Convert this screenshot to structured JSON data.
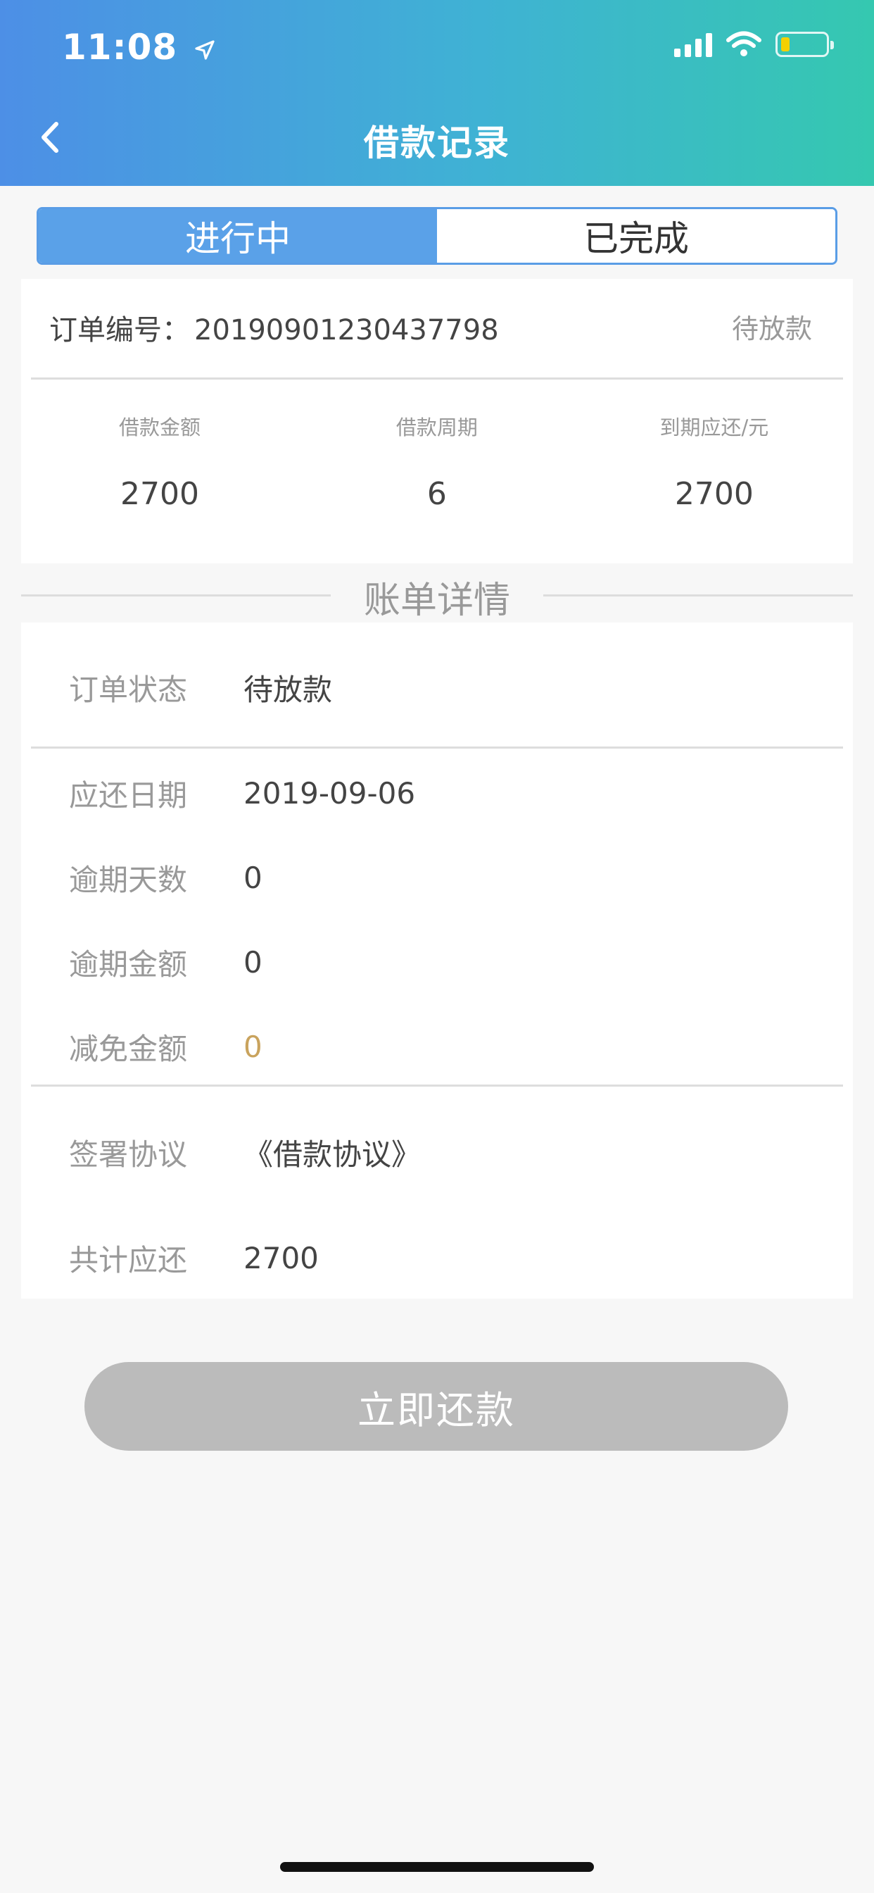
{
  "status_bar": {
    "time": "11:08"
  },
  "header": {
    "title": "借款记录"
  },
  "tabs": [
    {
      "label": "进行中",
      "active": true
    },
    {
      "label": "已完成",
      "active": false
    }
  ],
  "order": {
    "number_label": "订单编号：",
    "number": "20190901230437798",
    "status": "待放款",
    "stats": [
      {
        "label": "借款金额",
        "value": "2700"
      },
      {
        "label": "借款周期",
        "value": "6"
      },
      {
        "label": "到期应还/元",
        "value": "2700"
      }
    ]
  },
  "section_title": "账单详情",
  "details": {
    "order_status": {
      "label": "订单状态",
      "value": "待放款"
    },
    "due_date": {
      "label": "应还日期",
      "value": "2019-09-06"
    },
    "overdue_days": {
      "label": "逾期天数",
      "value": "0"
    },
    "overdue_amount": {
      "label": "逾期金额",
      "value": "0"
    },
    "waived_amount": {
      "label": "减免金额",
      "value": "0"
    },
    "agreement": {
      "label": "签署协议",
      "value": "《借款协议》"
    },
    "total_due": {
      "label": "共计应还",
      "value": "2700"
    }
  },
  "repay_button": {
    "label": "立即还款"
  },
  "colors": {
    "header_gradient_start": "#4d8fe6",
    "header_gradient_end": "#35c8b0",
    "tab_active": "#5aa1e8",
    "button_disabled": "#bbbbbb",
    "waived_amount": "#c9a35d"
  }
}
